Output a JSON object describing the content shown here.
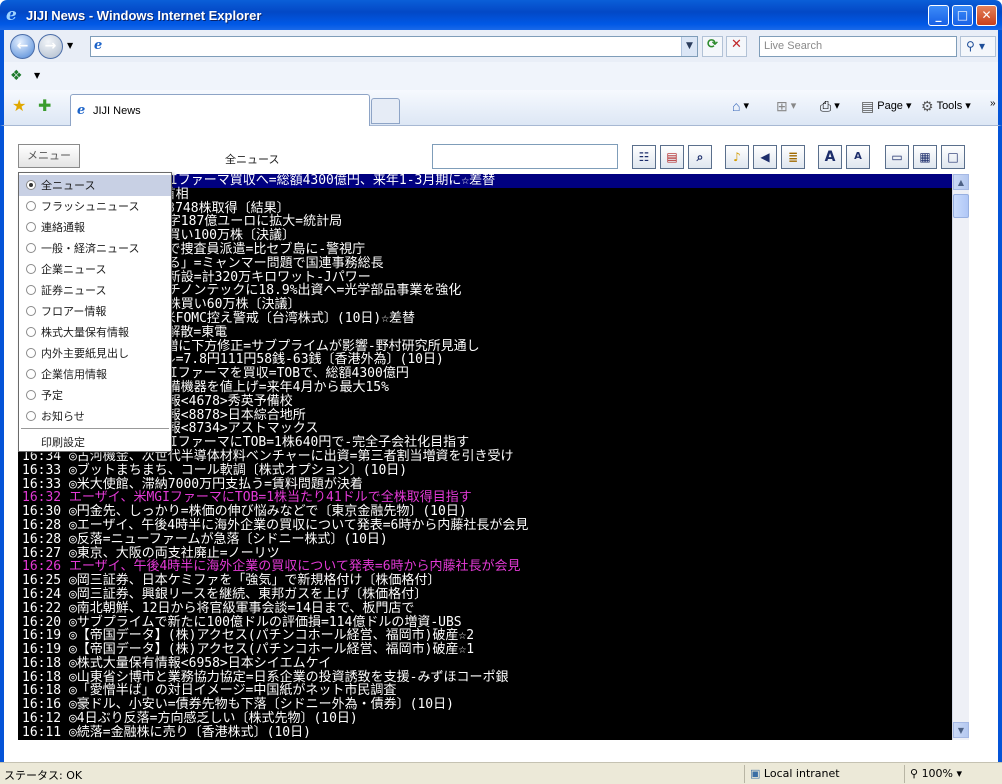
{
  "window": {
    "title": "JIJI News - Windows Internet Explorer"
  },
  "address_bar": {
    "url": "",
    "search_placeholder": "Live Search"
  },
  "tabs": [
    {
      "label": "JIJI News"
    }
  ],
  "command_bar": {
    "page_label": "Page",
    "tools_label": "Tools"
  },
  "toolbar": {
    "menu_label": "メニュー",
    "category_label": "全ニュース",
    "filter_value": ""
  },
  "menu_items": [
    {
      "label": "全ニュース",
      "selected": true
    },
    {
      "label": "フラッシュニュース"
    },
    {
      "label": "連絡通報"
    },
    {
      "label": "一般・経済ニュース"
    },
    {
      "label": "企業ニュース"
    },
    {
      "label": "証券ニュース"
    },
    {
      "label": "フロアー情報"
    },
    {
      "label": "株式大量保有情報"
    },
    {
      "label": "内外主要紙見出し"
    },
    {
      "label": "企業信用情報"
    },
    {
      "label": "予定"
    },
    {
      "label": "お知らせ"
    }
  ],
  "menu_print_label": "印刷設定",
  "news": [
    {
      "text": "16:44 ◎エーザイ、米MGIファーマ買収へ=総額4300億円、来年1-3月期に☆差替",
      "style": "hl"
    },
    {
      "text": "16:44 ◎長期的視野で=首相"
    },
    {
      "text": "16:43 ◎ニッキ、自社株3748株取得〔結果〕"
    },
    {
      "text": "16:43 ◎ユーロ圏貿易黒字187億ユーロに拡大=統計局"
    },
    {
      "text": "16:42 ◎ナガイ、自社株買い100万株〔決議〕"
    },
    {
      "text": "16:42 ◎タイ、記者殺害で捜査員派遣=比セブ島に-警視庁"
    },
    {
      "text": "16:41 ◎「民主化はつある」=ミャンマー問題で国連事務総長"
    },
    {
      "text": "16:41 ◎中国で発電所を新設=計320万キロワット-Jパワー"
    },
    {
      "text": "16:40 ◎光学エレクトロチノンテックに18.9%出資へ=光学部品事業を強化"
    },
    {
      "text": "16:40 ◎イービス、自社株買い60万株〔決議〕"
    },
    {
      "text": "16:39 ◎台湾株は続落=米FOMC控え警戒〔台湾株式〕(10日)☆差替"
    },
    {
      "text": "16:39 ◎サンライズ社を解散=東電"
    },
    {
      "text": "16:38 ◎今期業績は10%増に下方修正=サブプライムが影響-野村研究所見通し"
    },
    {
      "text": "16:38 ◎ドル買い、1ドル=7.8円111円58銭-63銭〔香港外為〕(10日)"
    },
    {
      "text": "16:37 ◎エーザイ、米MGIファーマを買収=TOBで、総額4300億円"
    },
    {
      "text": "16:37 ◎自動車各社、設備機器を値上げ=来年4月から最大15%"
    },
    {
      "text": "16:36 ◎株式大量保有情報<4678>秀英予備校"
    },
    {
      "text": "16:36 ◎株式大量保有情報<8878>日本綜合地所"
    },
    {
      "text": "16:35 ◎株式大量保有情報<8734>アストマックス"
    },
    {
      "text": "16:34 ◎エーザイ、米MGIファーマにTOB=1株640円で-完全子会社化目指す"
    },
    {
      "text": "16:34 ◎古河機金、次世代半導体材料ベンチャーに出資=第三者割当増資を引き受け"
    },
    {
      "text": "16:33 ◎ブットまちまち、コール軟調〔株式オプション〕(10日)"
    },
    {
      "text": "16:33 ◎米大使館、滞納7000万円支払う=賃料問題が決着"
    },
    {
      "text": "16:32 エーザイ、米MGIファーマにTOB=1株当たり41ドルで全株取得目指す",
      "style": "mg"
    },
    {
      "text": "16:30 ◎円金先、しっかり=株価の伸び悩みなどで〔東京金融先物〕(10日)"
    },
    {
      "text": "16:28 ◎エーザイ、午後4時半に海外企業の買収について発表=6時から内藤社長が会見"
    },
    {
      "text": "16:28 ◎反落=ニューファームが急落〔シドニー株式〕(10日)"
    },
    {
      "text": "16:27 ◎東京、大阪の両支社廃止=ノーリツ"
    },
    {
      "text": "16:26 エーザイ、午後4時半に海外企業の買収について発表=6時から内藤社長が会見",
      "style": "mg"
    },
    {
      "text": "16:25 ◎岡三証券、日本ケミファを「強気」で新規格付け〔株価格付〕"
    },
    {
      "text": "16:24 ◎岡三証券、興銀リースを継続、東邦ガスを上げ〔株価格付〕"
    },
    {
      "text": "16:22 ◎南北朝鮮、12日から将官級軍事会談=14日まで、板門店で"
    },
    {
      "text": "16:20 ◎サブプライムで新たに100億ドルの評価損=114億ドルの増資-UBS"
    },
    {
      "text": "16:19 ◎【帝国データ】(株)アクセス(パチンコホール経営、福岡市)破産☆2"
    },
    {
      "text": "16:19 ◎【帝国データ】(株)アクセス(パチンコホール経営、福岡市)破産☆1"
    },
    {
      "text": "16:18 ◎株式大量保有情報<6958>日本シイエムケイ"
    },
    {
      "text": "16:18 ◎山東省シ博市と業務協力協定=日系企業の投資誘致を支援-みずほコーポ銀"
    },
    {
      "text": "16:18 ◎「愛憎半ば」の対日イメージ=中国紙がネット市民調査"
    },
    {
      "text": "16:16 ◎豪ドル、小安い=債券先物も下落〔シドニー外為・債券〕(10日)"
    },
    {
      "text": "16:12 ◎4日ぶり反落=方向感乏しい〔株式先物〕(10日)"
    },
    {
      "text": "16:11 ◎続落=金融株に売り〔香港株式〕(10日)"
    }
  ],
  "status_bar": {
    "status_text": "ステータス: OK",
    "zone": "Local intranet",
    "zoom": "100%"
  },
  "colors": {
    "highlight": "#000080",
    "magenta": "#e33ad6",
    "titlebar": "#0454d8"
  }
}
